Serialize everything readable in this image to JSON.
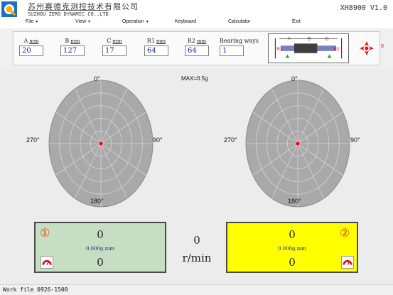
{
  "titlebar": {
    "company_cn": "苏州赛德克测控技术有限公司",
    "company_en": "SUZHOU ZERO DYNAMIC CO.,LTD",
    "version": "XH8900 V1.0"
  },
  "menu": {
    "file": "File",
    "view": "View",
    "operation": "Operation",
    "keyboard": "Keyboard",
    "calculator": "Calculator",
    "exit": "Exit"
  },
  "params": {
    "a": {
      "label": "A",
      "unit": "mm",
      "value": "20"
    },
    "b": {
      "label": "B",
      "unit": "mm",
      "value": "127"
    },
    "c": {
      "label": "C",
      "unit": "mm",
      "value": "17"
    },
    "r1": {
      "label": "R1",
      "unit": "mm",
      "value": "64"
    },
    "r2": {
      "label": "R2",
      "unit": "mm",
      "value": "64"
    },
    "bearing": {
      "label": "Bearing ways",
      "value": "1"
    }
  },
  "diagram": {
    "a": "A",
    "b": "B",
    "c": "C",
    "r1": "R1",
    "r2": "R2"
  },
  "warning_count": "0",
  "polar": {
    "max_label": "MAX=0.5g",
    "angle_top": "0°",
    "angle_right": "90°",
    "angle_bottom": "180°",
    "angle_left": "270°"
  },
  "readouts": {
    "left": {
      "index": "①",
      "value_top": "0",
      "unbalance": "0.000g.mm",
      "value_bottom": "0"
    },
    "right": {
      "index": "②",
      "value_top": "0",
      "unbalance": "0.000g.mm",
      "value_bottom": "0"
    }
  },
  "speed": {
    "value": "0",
    "unit": "r/min"
  },
  "status": {
    "work_file": "Work file 0926-1500"
  },
  "colors": {
    "left_panel": "#c6dfc3",
    "right_panel": "#ffff00",
    "polar_fill": "#a9a9a9",
    "center_dot": "#ff0000"
  }
}
